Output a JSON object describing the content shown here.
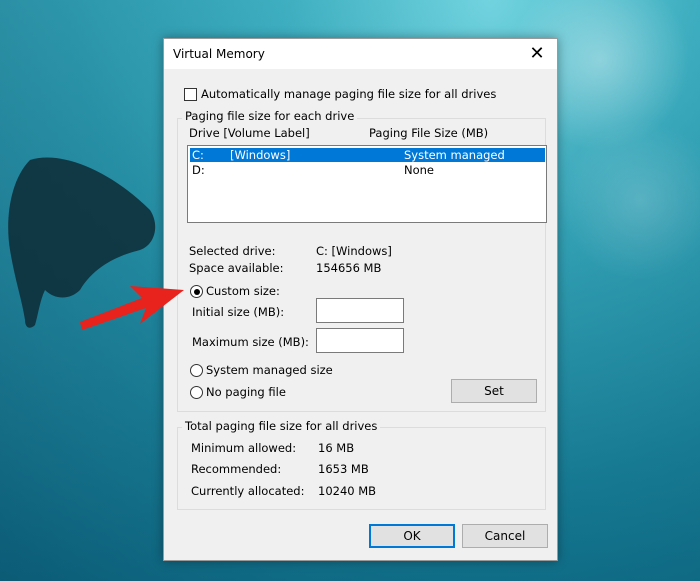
{
  "dialog": {
    "title": "Virtual Memory",
    "auto_manage_label": "Automatically manage paging file size for all drives",
    "auto_manage_checked": false,
    "paging_group_title": "Paging file size for each drive",
    "list_headers": {
      "drive": "Drive  [Volume Label]",
      "size": "Paging File Size (MB)"
    },
    "drives": [
      {
        "drive": "C:",
        "label": "[Windows]",
        "size": "System managed",
        "selected": true
      },
      {
        "drive": "D:",
        "label": "",
        "size": "None",
        "selected": false
      }
    ],
    "selected_drive_label": "Selected drive:",
    "selected_drive_value": "C:  [Windows]",
    "space_available_label": "Space available:",
    "space_available_value": "154656 MB",
    "custom_size_label": "Custom size:",
    "initial_size_label": "Initial size (MB):",
    "initial_size_value": "",
    "maximum_size_label": "Maximum size (MB):",
    "maximum_size_value": "",
    "system_managed_label": "System managed size",
    "no_paging_label": "No paging file",
    "selected_option": "custom",
    "set_button": "Set",
    "total_group_title": "Total paging file size for all drives",
    "min_allowed_label": "Minimum allowed:",
    "min_allowed_value": "16 MB",
    "recommended_label": "Recommended:",
    "recommended_value": "1653 MB",
    "allocated_label": "Currently allocated:",
    "allocated_value": "10240 MB",
    "ok_button": "OK",
    "cancel_button": "Cancel"
  },
  "colors": {
    "selection": "#0078d7",
    "arrow": "#e8221c",
    "dialog_bg": "#f0f0f0"
  },
  "icons": {
    "close": "close-icon",
    "annotation": "red-arrow-icon"
  }
}
